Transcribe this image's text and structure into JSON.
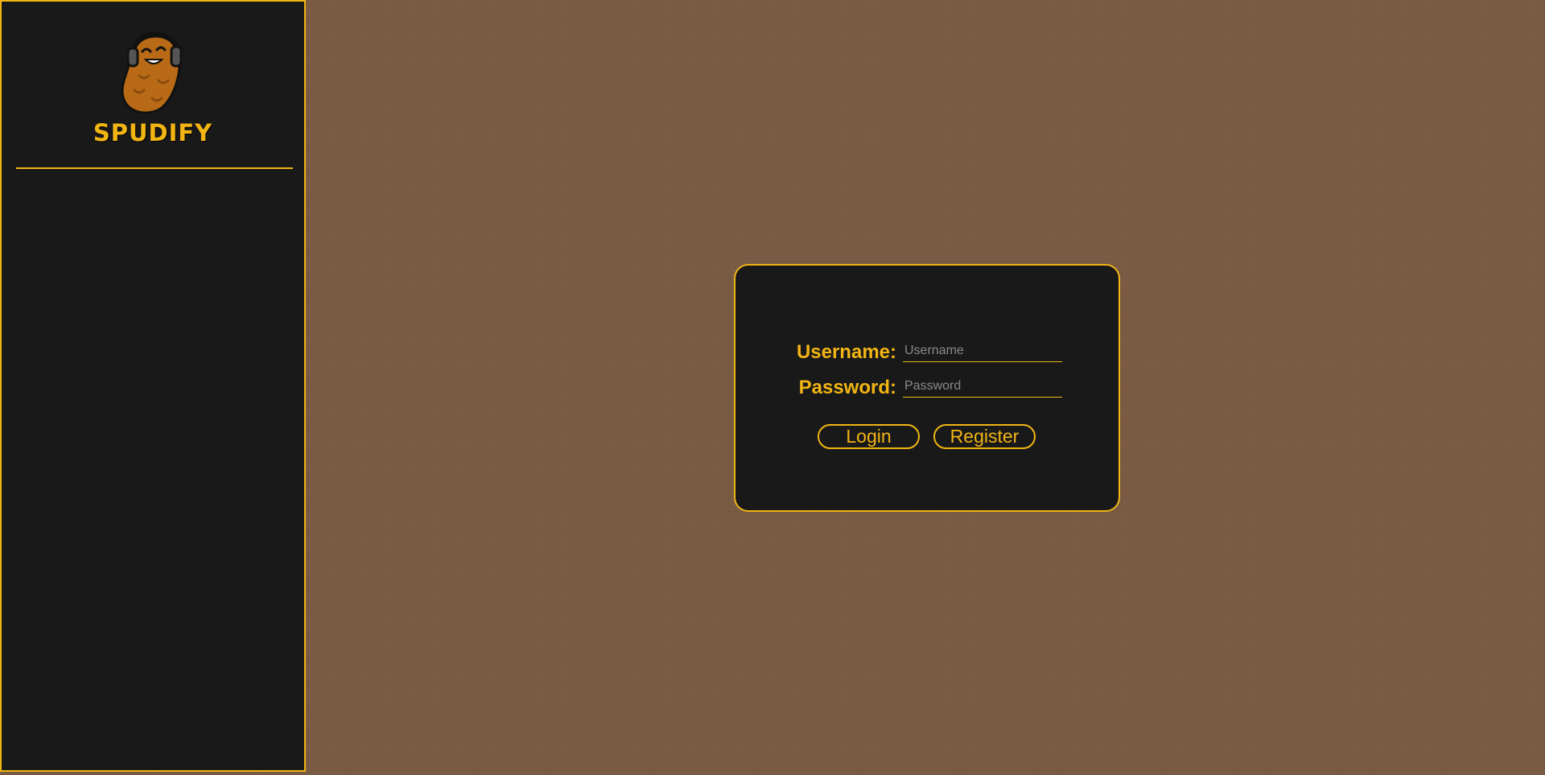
{
  "app": {
    "brand_name": "SPUDIFY"
  },
  "colors": {
    "accent": "#f0b613",
    "panel": "#191919",
    "background": "#7a5a42"
  },
  "logo": {
    "icon": "potato-headphones-mascot-icon"
  },
  "login_form": {
    "username_label": "Username:",
    "username_placeholder": "Username",
    "username_value": "",
    "password_label": "Password:",
    "password_placeholder": "Password",
    "password_value": "",
    "login_button": "Login",
    "register_button": "Register"
  }
}
